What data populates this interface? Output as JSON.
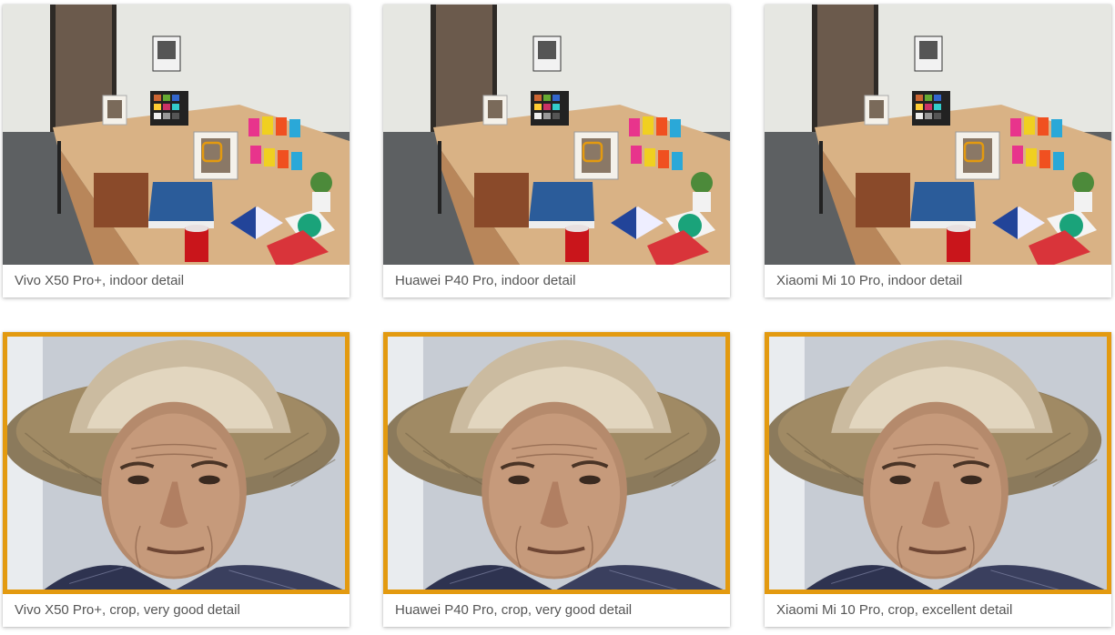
{
  "accent_color": "#E39A10",
  "gallery": {
    "items": [
      {
        "caption": "Vivo X50 Pro+, indoor detail",
        "image": "indoor-scene-photo"
      },
      {
        "caption": "Huawei P40 Pro, indoor detail",
        "image": "indoor-scene-photo"
      },
      {
        "caption": "Xiaomi Mi 10 Pro, indoor detail",
        "image": "indoor-scene-photo"
      },
      {
        "caption": "Vivo X50 Pro+, crop, very good detail",
        "image": "portrait-crop-photo"
      },
      {
        "caption": "Huawei P40 Pro, crop, very good detail",
        "image": "portrait-crop-photo"
      },
      {
        "caption": "Xiaomi Mi 10 Pro, crop, excellent detail",
        "image": "portrait-crop-photo"
      }
    ]
  }
}
